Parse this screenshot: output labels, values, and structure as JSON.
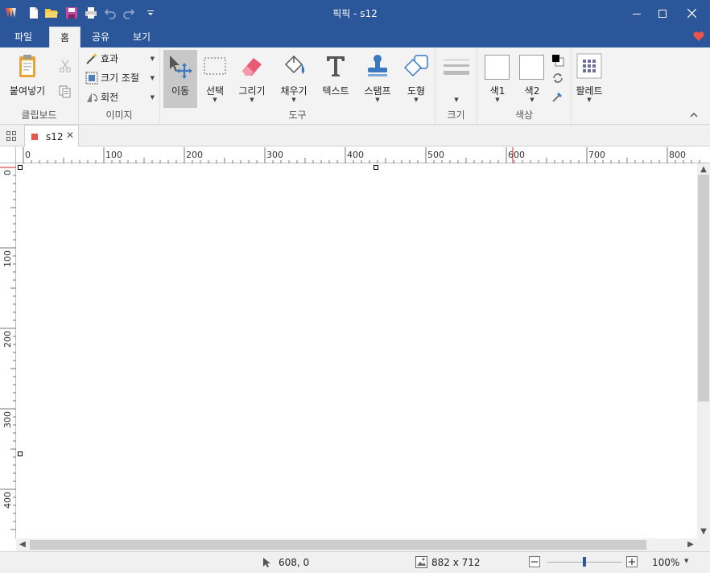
{
  "app": {
    "title": "픽픽 - s12"
  },
  "menu_tabs": [
    "파일",
    "홈",
    "공유",
    "보기"
  ],
  "active_tab": "홈",
  "ribbon": {
    "clipboard": {
      "paste": "붙여넣기",
      "group": "클립보드"
    },
    "image": {
      "effects": "효과",
      "resize": "크기 조절",
      "rotate": "회전",
      "group": "이미지"
    },
    "tools": {
      "move": "이동",
      "select": "선택",
      "draw": "그리기",
      "fill": "채우기",
      "text": "텍스트",
      "stamp": "스탬프",
      "shape": "도형",
      "group": "도구"
    },
    "size": {
      "group": "크기"
    },
    "color": {
      "color1": "색1",
      "color2": "색2",
      "group": "색상"
    },
    "palette": {
      "label": "팔레트"
    }
  },
  "document": {
    "tab_name": "s12"
  },
  "ruler": {
    "h_labels": [
      "0",
      "100",
      "200",
      "300",
      "400",
      "500",
      "600",
      "700",
      "800"
    ],
    "v_labels": [
      "0",
      "100",
      "200",
      "300",
      "400"
    ]
  },
  "status": {
    "cursor": "608, 0",
    "image_size": "882 x 712",
    "zoom": "100%",
    "zoom_slider_value": 0.5
  },
  "colors": {
    "accent": "#2b579a",
    "heart": "#e8554e",
    "color1": "#ffffff",
    "color2": "#ffffff",
    "primary_swatch": "#000000"
  }
}
